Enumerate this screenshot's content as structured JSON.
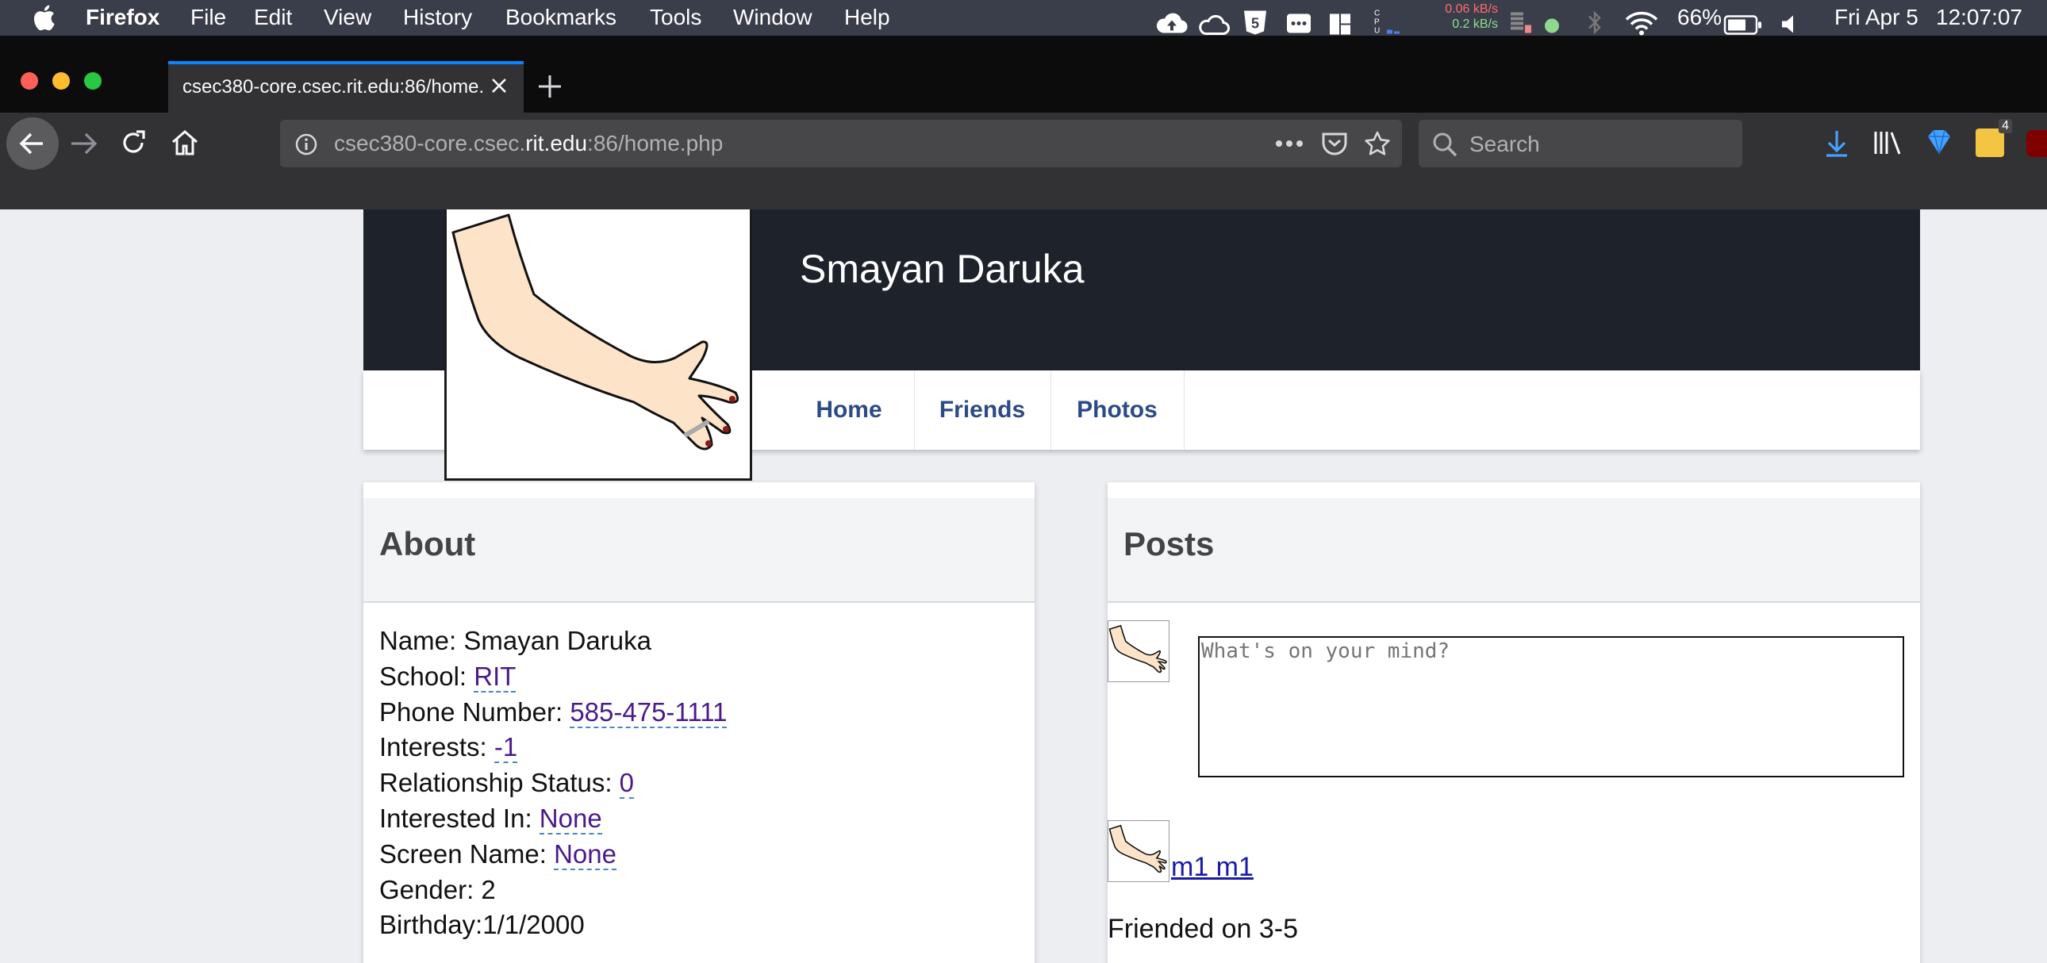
{
  "menubar": {
    "app_name": "Firefox",
    "menus": [
      "File",
      "Edit",
      "View",
      "History",
      "Bookmarks",
      "Tools",
      "Window",
      "Help"
    ],
    "net_up": "0.06 kB/s",
    "net_down": "0.2 kB/s",
    "battery": "66%",
    "date": "Fri Apr 5",
    "time": "12:07:07"
  },
  "browser": {
    "tab_title": "csec380-core.csec.rit.edu:86/home.php",
    "url_prefix": "csec380-core.csec.",
    "url_host": "rit.edu",
    "url_suffix": ":86/home.php",
    "search_placeholder": "Search",
    "library_badge": "4"
  },
  "profile": {
    "name": "Smayan Daruka",
    "nav": [
      "Home",
      "Friends",
      "Photos"
    ]
  },
  "about": {
    "heading": "About",
    "name_label": "Name: Smayan Daruka",
    "school_label": "School: ",
    "school": "RIT",
    "phone_label": "Phone Number: ",
    "phone": "585-475-1111",
    "interests_label": "Interests: ",
    "interests": "-1",
    "relationship_label": "Relationship Status: ",
    "relationship": "0",
    "interested_in_label": "Interested In: ",
    "interested_in": "None",
    "screen_name_label": "Screen Name: ",
    "screen_name": "None",
    "gender_label": "Gender: 2",
    "birthday_label": "Birthday:1/1/2000"
  },
  "posts": {
    "heading": "Posts",
    "compose_placeholder": "What's on your mind?",
    "friend_name": "m1 m1",
    "friended_on": "Friended on 3-5"
  },
  "colors": {
    "menubar": "#3a3e4a",
    "tab_accent": "#0a84ff",
    "cover": "#1e222b",
    "nav_link": "#2b4a86",
    "link_visited": "#4b1a8a"
  }
}
